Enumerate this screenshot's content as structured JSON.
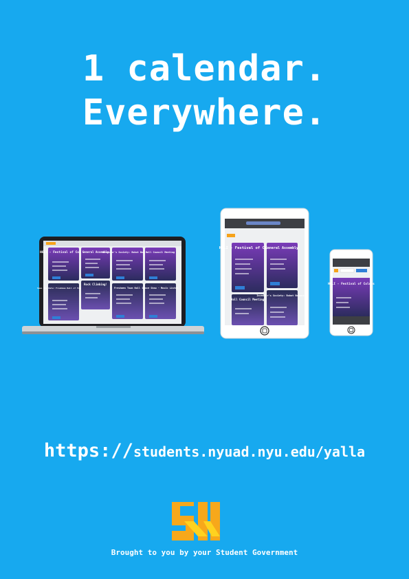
{
  "headline": {
    "line1": "1 calendar.",
    "line2": "Everywhere."
  },
  "url": {
    "protocol": "https://",
    "path": "students.nyuad.nyu.edu/yalla"
  },
  "credit": "Brought to you by your Student Government",
  "cards": {
    "holi": "HOLI - Festival of Colors",
    "general_assembly": "General Assembly",
    "robot_bonanza": "Inventor's Society: Robot Bonanza!",
    "hall_council": "Hall Council Meeting",
    "save_the_date": "Save the Date: Freshman Ball of Your Dorm!",
    "rock_climbing": "Rock Climbing!",
    "freshmen_town_hall": "Freshmen Town Hall",
    "dance_show": "Dance Show - Music Listen"
  },
  "colors": {
    "background": "#17a9ef",
    "text": "#ffffff",
    "card_purple": "#6a3aa8",
    "card_dark": "#27254f",
    "logo_orange": "#f7a81b",
    "logo_yellow": "#ffd21f"
  },
  "icons": [
    "laptop-icon",
    "tablet-icon",
    "phone-icon",
    "student-government-logo-icon"
  ]
}
